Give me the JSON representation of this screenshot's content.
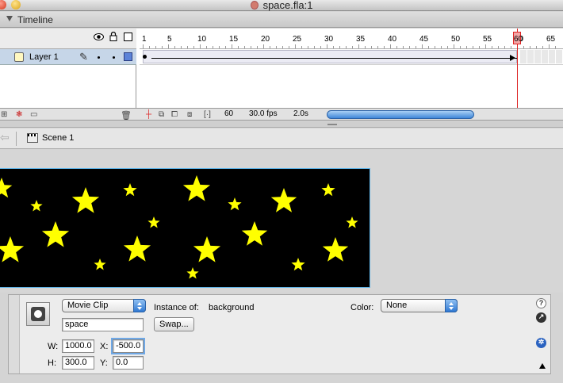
{
  "window": {
    "title": "space.fla:1"
  },
  "timeline": {
    "panel_title": "Timeline",
    "ruler_numbers": [
      "1",
      "5",
      "10",
      "15",
      "20",
      "25",
      "30",
      "35",
      "40",
      "45",
      "50",
      "55",
      "60",
      "65"
    ],
    "current_frame_marker": "60",
    "layers": [
      {
        "name": "Layer 1"
      }
    ],
    "status": {
      "current_frame": "60",
      "frame_rate": "30.0 fps",
      "elapsed_time": "2.0s"
    }
  },
  "editbar": {
    "scene_label": "Scene 1"
  },
  "stage": {
    "background_color": "#000000",
    "star_color": "#ffff00"
  },
  "properties": {
    "symbol_type": "Movie Clip",
    "instance_name": "space",
    "instance_of_label": "Instance of:",
    "instance_of_value": "background",
    "color_label": "Color:",
    "color_value": "None",
    "swap_label": "Swap...",
    "w_label": "W:",
    "w_value": "1000.0",
    "h_label": "H:",
    "h_value": "300.0",
    "x_label": "X:",
    "x_value": "-500.0",
    "y_label": "Y:",
    "y_value": "0.0"
  }
}
